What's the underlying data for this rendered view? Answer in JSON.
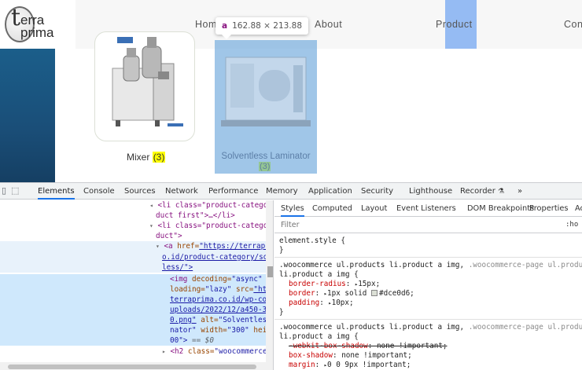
{
  "site": {
    "logo": {
      "letter": "t",
      "line1": "erra",
      "line2": "prima"
    },
    "nav": {
      "home": "Hom",
      "about": "About",
      "product": "Product",
      "contact": "Con"
    },
    "tooltip": {
      "tag": "a",
      "size": "162.88 × 213.88"
    },
    "products": [
      {
        "name": "Mixer",
        "count": "(3)"
      },
      {
        "name": "Solventless Laminator",
        "count": "(3)"
      }
    ]
  },
  "devtools": {
    "tabs": [
      "Elements",
      "Console",
      "Sources",
      "Network",
      "Performance",
      "Memory",
      "Application",
      "Security",
      "Lighthouse",
      "Recorder",
      "»"
    ],
    "recorder_icon": "flask-icon",
    "dom": {
      "l1a": "<li class=\"product-category",
      "l1b": "duct first\">…</li>",
      "l2a": "<li class=\"product-category",
      "l2b": "duct\">",
      "l3a_tag": "<a ",
      "l3a_attr": "href=",
      "l3a_val": "\"https://terraprimi",
      "l3b": "o.id/product-category/sol",
      "l3c": "less/\">",
      "l4a_tag": "<img ",
      "l4a_attr": "decoding=",
      "l4a_val": "\"async\"",
      "l4b_attr": "loading=",
      "l4b_val": "\"lazy\"",
      "l4b_attr2": " src=",
      "l4b_val2": "\"htt",
      "l4c": "terraprima.co.id/wp-con",
      "l4d": "uploads/2022/12/a450-30",
      "l4e_val": "0.png\"",
      "l4e_attr": " alt=",
      "l4e_val2": "\"Solventless",
      "l4f_val": "nator\"",
      "l4f_attr": " width=",
      "l4f_val2": "\"300\"",
      "l4f_attr2": " heig",
      "l4g": "00\">",
      "l4g_eq": " == $0",
      "l5_tag": "<h2 ",
      "l5_attr": "class=",
      "l5_val": "\"woocommerce-"
    },
    "subtabs": [
      "Styles",
      "Computed",
      "Layout",
      "Event Listeners",
      "DOM Breakpoints",
      "Properties",
      "Ac"
    ],
    "filter_placeholder": "Filter",
    "hov": ":ho",
    "styles": {
      "element_style": "element.style {",
      "close": "}",
      "rule1_sel": ".woocommerce ul.products li.product a img,",
      "rule1_sel_dim": " .woocommerce-page ul.products",
      "rule1_sel2": "li.product a img {",
      "rule1_props": [
        {
          "name": "border-radius",
          "value": "15px;"
        },
        {
          "name": "border",
          "value": "1px solid",
          "swatch": "#dce0d6",
          "value2": "#dce0d6;"
        },
        {
          "name": "padding",
          "value": "10px;"
        }
      ],
      "rule2_sel": ".woocommerce ul.products li.product a img,",
      "rule2_sel_dim": " .woocommerce-page ul.products",
      "rule2_sel2": "li.product a img {",
      "rule2_props": [
        {
          "name": "-webkit-box-shadow",
          "value": "none !important;"
        },
        {
          "name": "box-shadow",
          "value": "none !important;"
        },
        {
          "name": "margin",
          "value": "0 0 9px !important;"
        }
      ]
    }
  }
}
